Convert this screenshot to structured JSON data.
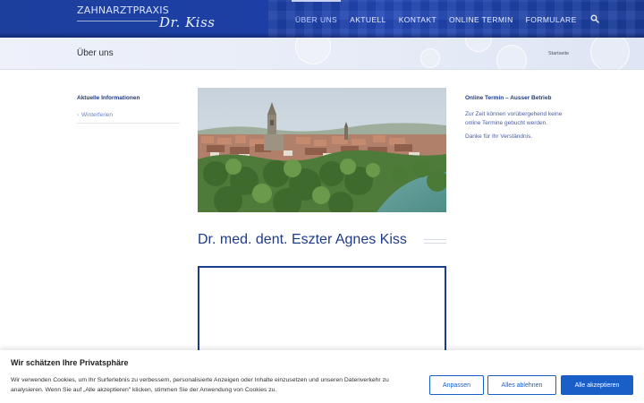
{
  "header": {
    "logo_top": "ZAHNARZTPRAXIS",
    "logo_script": "Dr. Kiss",
    "nav": [
      {
        "label": "ÜBER UNS",
        "active": true
      },
      {
        "label": "AKTUELL",
        "active": false
      },
      {
        "label": "KONTAKT",
        "active": false
      },
      {
        "label": "ONLINE TERMIN",
        "active": false
      },
      {
        "label": "FORMULARE",
        "active": false
      }
    ],
    "search_icon": "search-icon"
  },
  "titlebar": {
    "title": "Über uns",
    "breadcrumb": "Startseite"
  },
  "left_sidebar": {
    "title": "Aktuelle Informationen",
    "link": "Winterferien"
  },
  "main": {
    "heading": "Dr. med. dent. Eszter Agnes Kiss"
  },
  "right_sidebar": {
    "title": "Online Termin – Ausser Betrieb",
    "text": "Zur Zeit können vorübergehend keine online Termine gebucht werden.",
    "thanks": "Danke für Ihr Verständnis."
  },
  "cookie": {
    "title": "Wir schätzen Ihre Privatsphäre",
    "text": "Wir verwenden Cookies, um Ihr Surferlebnis zu verbessern, personalisierte Anzeigen oder Inhalte einzusetzen und unseren Datenverkehr zu analysieren. Wenn Sie auf „Alle akzeptieren\" klicken, stimmen Sie der Anwendung von Cookies zu.",
    "btn_customize": "Anpassen",
    "btn_reject": "Alles ablehnen",
    "btn_accept": "Alle akzeptieren"
  },
  "colors": {
    "header_blue": "#1d3fa6",
    "heading_blue": "#1f3b87",
    "button_blue": "#1a5ec8"
  }
}
